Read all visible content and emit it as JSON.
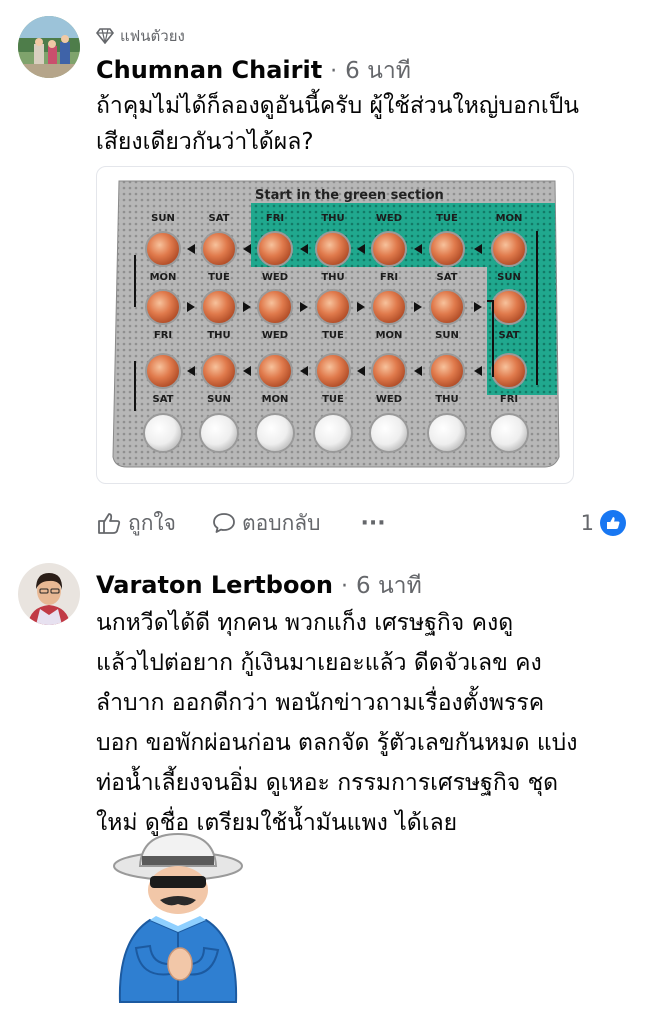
{
  "comment1": {
    "badge": "แฟนตัวยง",
    "author": "Chumnan Chairit",
    "time": "6 นาที",
    "text_lines": [
      "ถ้าคุมไม่ได้ก็ลองดูอันนี้ครับ ผู้ใช้ส่วนใหญ่บอกเป็น",
      "เสียงเดียวกันว่าได้ผล?"
    ],
    "image": {
      "header": "Start in the green section",
      "rows": [
        {
          "top": [
            "SUN",
            "SAT",
            "FRI",
            "THU",
            "WED",
            "TUE",
            "MON"
          ],
          "bottom": [
            "MON",
            "TUE",
            "WED",
            "THU",
            "FRI",
            "SAT",
            "SUN"
          ]
        },
        {
          "top": [
            "",
            "",
            "",
            "",
            "",
            "",
            ""
          ],
          "bottom": [
            "FRI",
            "THU",
            "WED",
            "TUE",
            "MON",
            "SUN",
            "SAT"
          ]
        },
        {
          "top": [
            "",
            "",
            "",
            "",
            "",
            "",
            ""
          ],
          "bottom": [
            "SAT",
            "SUN",
            "MON",
            "TUE",
            "WED",
            "THU",
            "FRI"
          ]
        }
      ]
    },
    "actions": {
      "like": "ถูกใจ",
      "reply": "ตอบกลับ",
      "more": "···",
      "reaction_count": "1"
    }
  },
  "comment2": {
    "author": "Varaton Lertboon",
    "time": "6 นาที",
    "text_lines": [
      "นกหวีดได้ดี ทุกคน  พวกแก็ง เศรษฐกิจ คงดู",
      "แล้วไปต่อยาก กู้เงินมาเยอะแล้ว  ดีดจัวเลข คง",
      "ลำบาก ออกดีกว่า  พอนักข่าวถามเรื่องตั้งพรรค",
      "บอก ขอพักผ่อนก่อน  ตลกจัด รู้ตัวเลขกันหมด แบ่ง",
      "ท่อน้ำเลี้ยงจนอิ่ม  ดูเหอะ กรรมการเศรษฐกิจ ชุด",
      "ใหม่ ดูชื่อ เตรียมใช้น้ำมันแพง ได้เลย"
    ]
  },
  "colors": {
    "text_primary": "#050505",
    "text_secondary": "#65676b",
    "like_blue": "#1877f2",
    "pack_green": "#1aa58a",
    "pill_orange": "#e07a4c"
  }
}
